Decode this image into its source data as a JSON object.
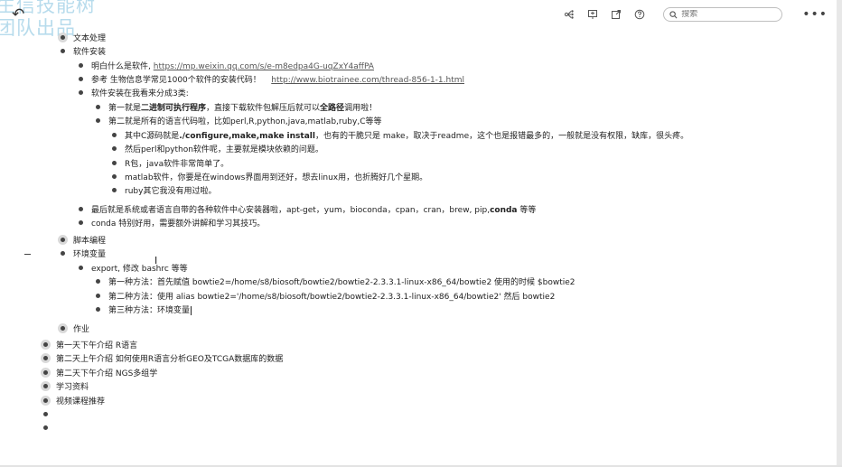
{
  "watermark": {
    "line1": "生信技能树",
    "line2": "团队出品"
  },
  "toolbar": {
    "search_placeholder": "搜索"
  },
  "outline": {
    "text_processing": "文本处理",
    "software_install": "软件安装",
    "understand_software_prefix": "明白什么是软件,",
    "understand_software_link": "https://mp.weixin.qq.com/s/e-m8edpa4G-uqZxY4affPA",
    "ref_prefix": "参考 生物信息学常见1000个软件的安装代码！",
    "ref_link": "http://www.biotrainee.com/thread-856-1-1.html",
    "install_types": "软件安装在我看来分成3类:",
    "type1_a": "第一就是",
    "type1_b": "二进制可执行程序",
    "type1_c": "，直接下载软件包解压后就可以",
    "type1_d": "全路径",
    "type1_e": "调用啦！",
    "type2": "第二就是所有的语言代码啦，比如perl,R,python,java,matlab,ruby,C等等",
    "c_a": "其中C源码就是",
    "c_b": "./configure,make,make install",
    "c_c": "，也有的干脆只是 make，取决于readme，这个也是报错最多的，一般就是没有权限，缺库，很头疼。",
    "perl_python": "然后perl和python软件呢，主要就是模块依赖的问题。",
    "r_java": "R包，java软件非常简单了。",
    "matlab": "matlab软件，你要是在windows界面用到还好，想去linux用，也折腾好几个星期。",
    "ruby": "ruby其它我没有用过啦。",
    "last_a": "最后就是系统或者语言自带的各种软件中心安装器啦，apt-get，yum，bioconda，cpan，cran，brew, pip,",
    "last_b": "conda",
    "last_c": " 等等",
    "conda": "conda 特别好用，需要额外讲解和学习其技巧。",
    "script_programming": "脚本编程",
    "env_var": "环境变量",
    "export": "export, 修改 bashrc 等等",
    "method1": "第一种方法：首先赋值 bowtie2=/home/s8/biosoft/bowtie2/bowtie2-2.3.3.1-linux-x86_64/bowtie2  使用的时候  $bowtie2",
    "method2": "第二种方法：使用 alias bowtie2='/home/s8/biosoft/bowtie2/bowtie2-2.3.3.1-linux-x86_64/bowtie2' 然后 bowtie2",
    "method3": "第三种方法：环境变量",
    "homework": "作业",
    "day1_pm": "第一天下午介绍 R语言",
    "day2_am": "第二天上午介绍 如何使用R语言分析GEO及TCGA数据库的数据",
    "day2_pm": "第二天下午介绍 NGS多组学",
    "materials": "学习资料",
    "videos": "视频课程推荐"
  }
}
